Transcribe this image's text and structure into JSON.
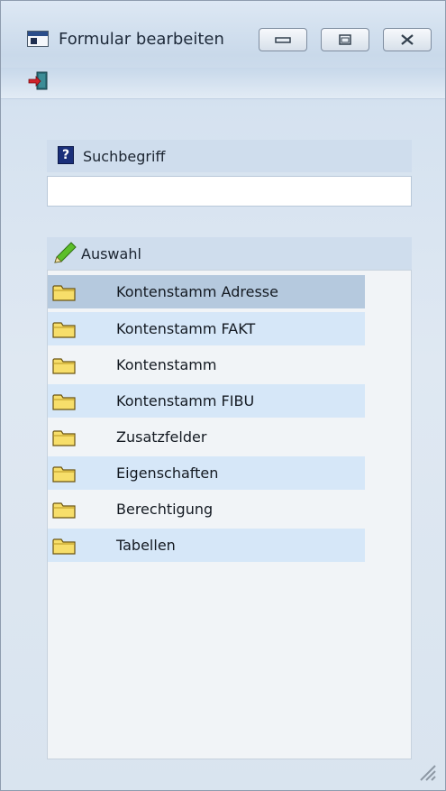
{
  "window": {
    "title": "Formular bearbeiten",
    "buttons": [
      "minimize",
      "maximize",
      "close"
    ]
  },
  "toolbar": {
    "exit_icon": "exit-door-icon"
  },
  "search": {
    "label": "Suchbegriff",
    "value": "",
    "placeholder": "",
    "icon": "help-icon"
  },
  "selection": {
    "label": "Auswahl",
    "icon": "pencil-icon",
    "items": [
      {
        "label": "Kontenstamm Adresse",
        "selected": true
      },
      {
        "label": "Kontenstamm FAKT"
      },
      {
        "label": "Kontenstamm"
      },
      {
        "label": "Kontenstamm FIBU"
      },
      {
        "label": "Zusatzfelder"
      },
      {
        "label": "Eigenschaften"
      },
      {
        "label": "Berechtigung"
      },
      {
        "label": "Tabellen"
      }
    ]
  },
  "colors": {
    "selected_row": "#b5c9de",
    "alt_row": "#d6e7f8",
    "header": "#cfdded"
  }
}
